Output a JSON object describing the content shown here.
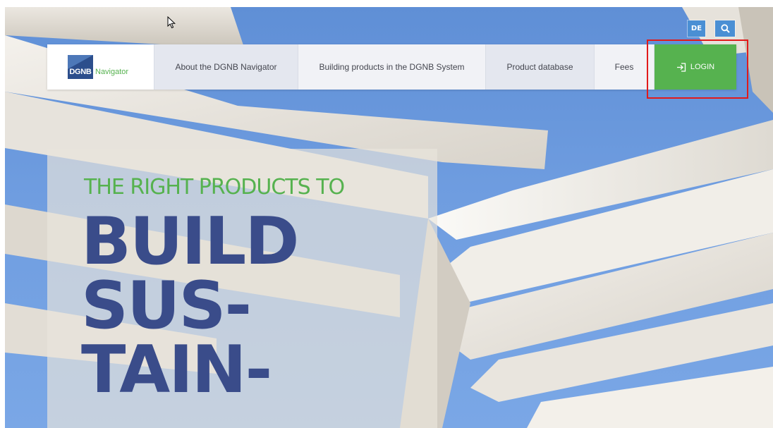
{
  "header": {
    "language_toggle": "DE",
    "search_icon": "search-icon"
  },
  "nav": {
    "logo": {
      "mark_text": "DGNB",
      "product_text": "Navigator"
    },
    "items": [
      {
        "label": "About the DGNB Navigator"
      },
      {
        "label": "Building products in the DGNB System"
      },
      {
        "label": "Product database"
      },
      {
        "label": "Fees"
      }
    ],
    "login": {
      "label": "LOGIN",
      "icon": "login-icon"
    }
  },
  "hero": {
    "kicker": "THE RIGHT PRODUCTS TO",
    "headline": [
      "BUILD",
      "SUS-",
      "TAIN-"
    ]
  },
  "colors": {
    "accent_green": "#56b24f",
    "headline_blue": "#3a4c8a",
    "utility_blue": "#4a8fd4",
    "highlight_red": "#e21a1a"
  }
}
